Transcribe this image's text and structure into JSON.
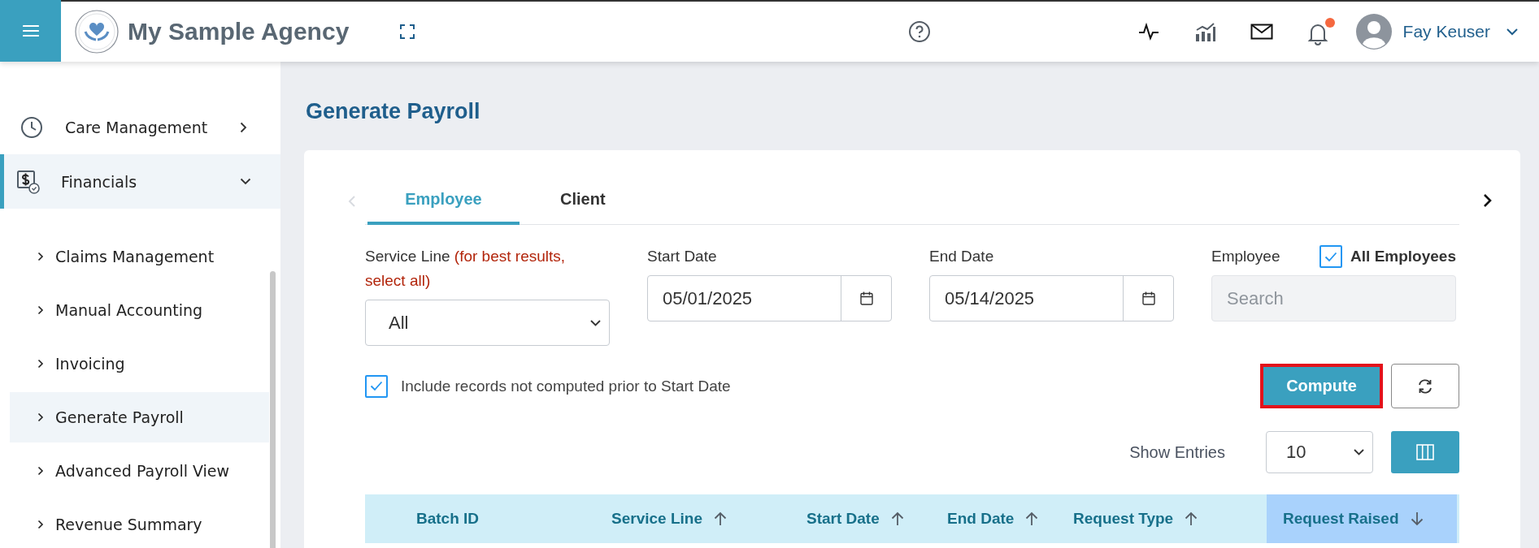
{
  "header": {
    "agency_name": "My Sample Agency",
    "user_name": "Fay Keuser",
    "notification_badge": true
  },
  "sidebar": {
    "items": [
      {
        "label": "Care Management",
        "expanded": false,
        "selected": false
      },
      {
        "label": "Financials",
        "expanded": true,
        "selected": true,
        "children": [
          {
            "label": "Claims Management",
            "selected": false
          },
          {
            "label": "Manual Accounting",
            "selected": false
          },
          {
            "label": "Invoicing",
            "selected": false
          },
          {
            "label": "Generate Payroll",
            "selected": true
          },
          {
            "label": "Advanced Payroll View",
            "selected": false
          },
          {
            "label": "Revenue Summary",
            "selected": false
          }
        ]
      }
    ]
  },
  "page_title": "Generate Payroll",
  "tabs": [
    {
      "label": "Employee",
      "selected": true
    },
    {
      "label": "Client",
      "selected": false
    }
  ],
  "form": {
    "service_line": {
      "label": "Service Line",
      "hint": "(for best results, select all)",
      "value": "All"
    },
    "start_date": {
      "label": "Start Date",
      "value": "05/01/2025"
    },
    "end_date": {
      "label": "End Date",
      "value": "05/14/2025"
    },
    "employee": {
      "label": "Employee",
      "placeholder": "Search",
      "disabled": true,
      "all_label": "All Employees",
      "all_checked": true
    },
    "include_prior": {
      "label": "Include records not computed prior to Start Date",
      "checked": true
    },
    "compute_label": "Compute"
  },
  "show_entries": {
    "label": "Show Entries",
    "value": "10"
  },
  "table": {
    "columns": [
      {
        "label": "Batch ID",
        "sortable": false,
        "selected": false
      },
      {
        "label": "Service Line",
        "sortable": true,
        "descending": false,
        "selected": false
      },
      {
        "label": "Start Date",
        "sortable": true,
        "descending": false,
        "selected": false
      },
      {
        "label": "End Date",
        "sortable": true,
        "descending": false,
        "selected": false
      },
      {
        "label": "Request Type",
        "sortable": true,
        "descending": false,
        "selected": false
      },
      {
        "label": "Request Raised",
        "sortable": true,
        "descending": true,
        "selected": true
      }
    ]
  }
}
